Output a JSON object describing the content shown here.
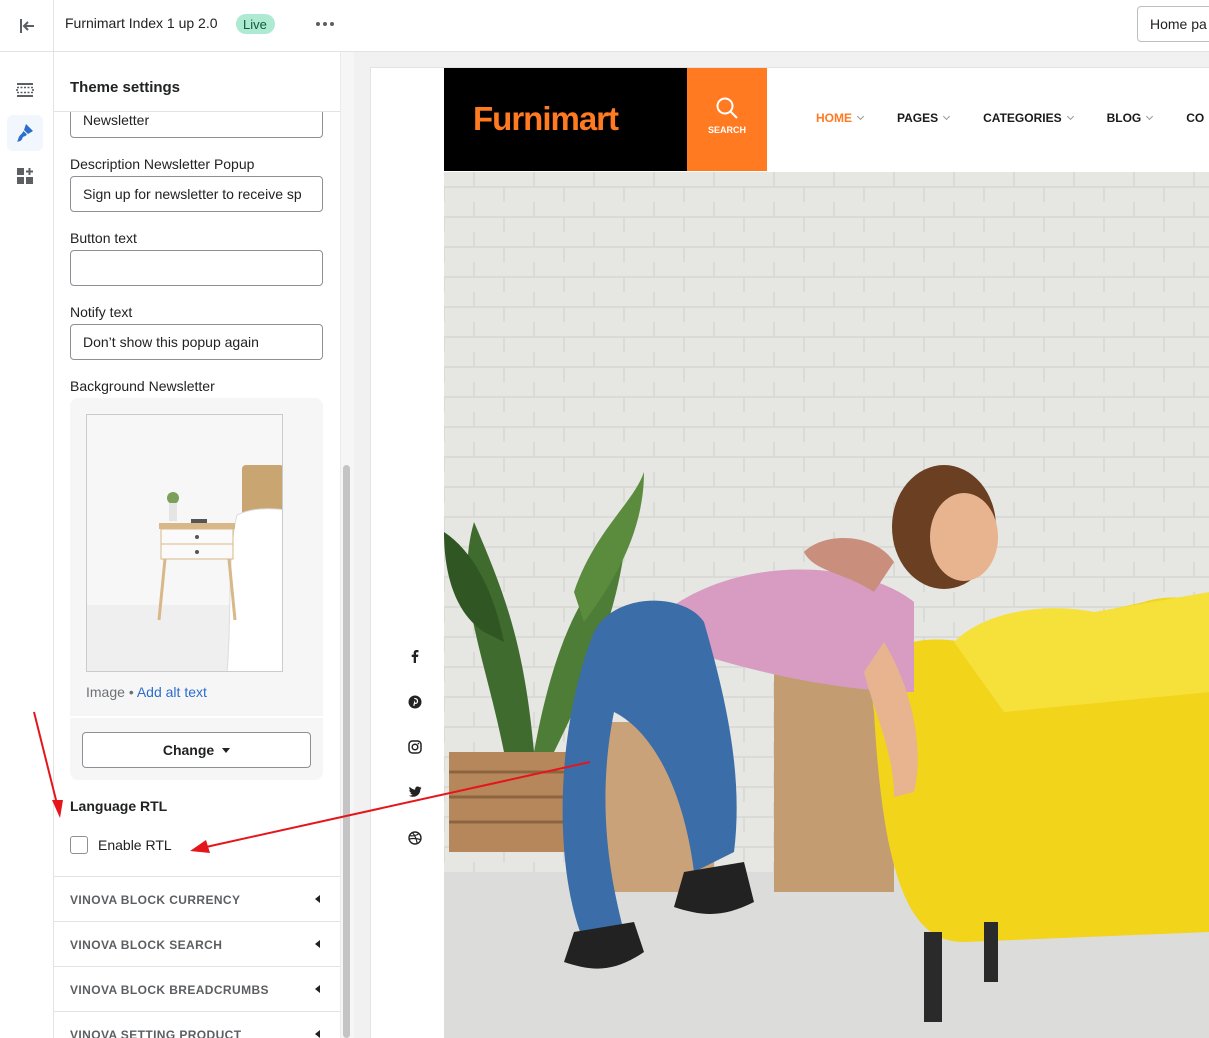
{
  "topbar": {
    "theme_name": "Furnimart Index 1 up 2.0",
    "status_badge": "Live",
    "page_selector": "Home pa"
  },
  "panel": {
    "title": "Theme settings",
    "fields": [
      {
        "label": "",
        "value": "Newsletter"
      },
      {
        "label": "Description Newsletter Popup",
        "value": "Sign up for newsletter to receive sp"
      },
      {
        "label": "Button text",
        "value": ""
      },
      {
        "label": "Notify text",
        "value": "Don’t show this popup again"
      }
    ],
    "background_newsletter": {
      "label": "Background Newsletter",
      "meta_prefix": "Image",
      "meta_separator": "•",
      "alt_link": "Add alt text",
      "change_button": "Change"
    },
    "rtl": {
      "heading": "Language RTL",
      "checkbox_label": "Enable RTL",
      "checked": false
    },
    "accordions": [
      "VINOVA BLOCK CURRENCY",
      "VINOVA BLOCK SEARCH",
      "VINOVA BLOCK BREADCRUMBS",
      "VINOVA SETTING PRODUCT"
    ]
  },
  "preview": {
    "logo_text": "Furnimart",
    "search_label": "SEARCH",
    "nav": [
      "HOME",
      "PAGES",
      "CATEGORIES",
      "BLOG",
      "CO"
    ],
    "social_icons": [
      "facebook-icon",
      "pinterest-icon",
      "instagram-icon",
      "twitter-icon",
      "dribbble-icon"
    ]
  },
  "colors": {
    "accent": "#ff7a21",
    "badge_bg": "#aee9d1",
    "link": "#2c6ecb",
    "annotation_arrow": "#e5161b"
  }
}
